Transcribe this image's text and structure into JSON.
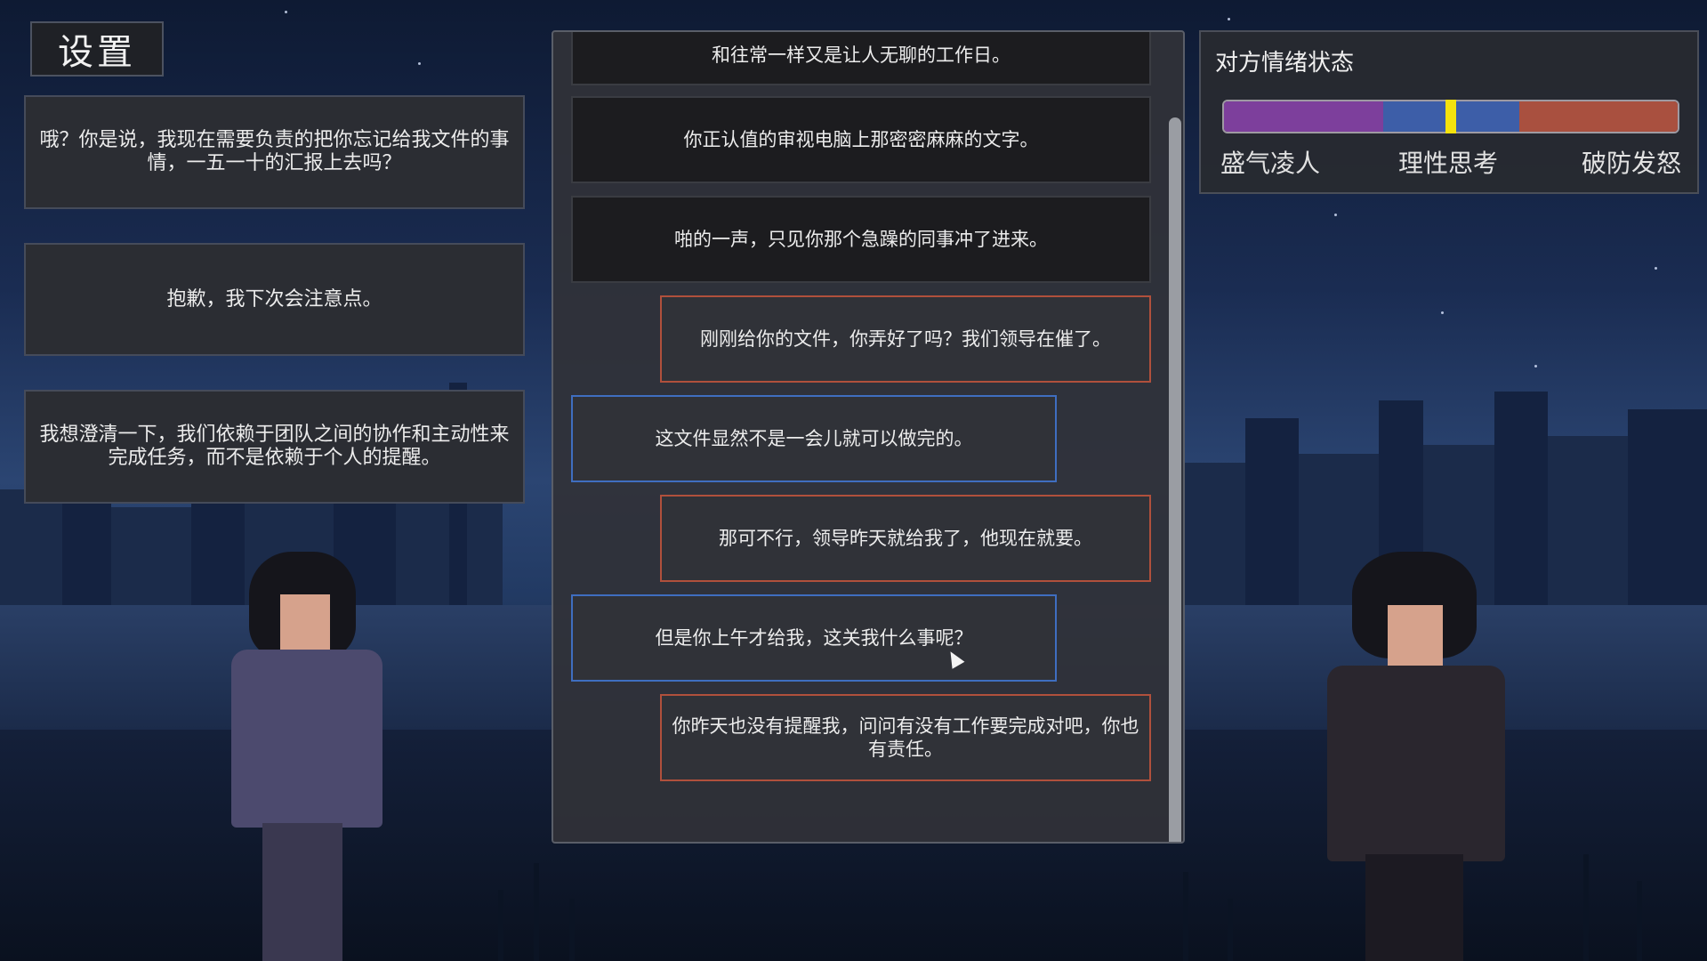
{
  "settings": {
    "label": "设置"
  },
  "options": [
    {
      "text": "哦？你是说，我现在需要负责的把你忘记给我文件的事情，一五一十的汇报上去吗？"
    },
    {
      "text": "抱歉，我下次会注意点。"
    },
    {
      "text": "我想澄清一下，我们依赖于团队之间的协作和主动性来完成任务，而不是依赖于个人的提醒。"
    }
  ],
  "dialogue": [
    {
      "speaker": "narration",
      "text": "和往常一样又是让人无聊的工作日。"
    },
    {
      "speaker": "narration",
      "text": "你正认值的审视电脑上那密密麻麻的文字。"
    },
    {
      "speaker": "narration",
      "text": "啪的一声，只见你那个急躁的同事冲了进来。"
    },
    {
      "speaker": "other",
      "text": "刚刚给你的文件，你弄好了吗？我们领导在催了。"
    },
    {
      "speaker": "self",
      "text": "这文件显然不是一会儿就可以做完的。"
    },
    {
      "speaker": "other",
      "text": "那可不行，领导昨天就给我了，他现在就要。"
    },
    {
      "speaker": "self",
      "text": "但是你上午才给我，这关我什么事呢？"
    },
    {
      "speaker": "other",
      "text": "你昨天也没有提醒我，问问有没有工作要完成对吧，你也有责任。"
    }
  ],
  "emotion": {
    "title": "对方情绪状态",
    "labels": {
      "left": "盛气凌人",
      "middle": "理性思考",
      "right": "破防发怒"
    },
    "level": 0.5,
    "colors": {
      "left": "#7d3f9c",
      "middle": "#3d5ea8",
      "right": "#a9503f",
      "marker": "#f4e20d"
    }
  }
}
